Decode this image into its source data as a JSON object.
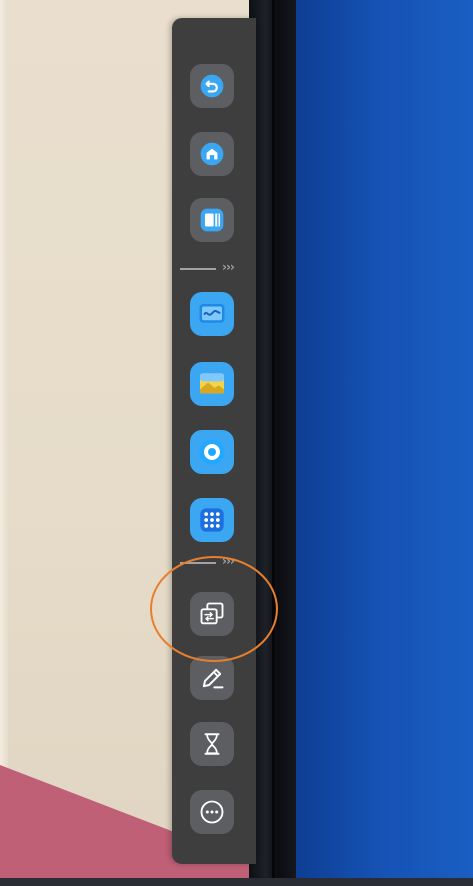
{
  "toolbar": {
    "separator_chevrons": "›››",
    "buttons": [
      {
        "name": "back-button",
        "icon": "undo-arrow-icon"
      },
      {
        "name": "home-button",
        "icon": "home-icon"
      },
      {
        "name": "multitask-button",
        "icon": "recent-apps-icon"
      },
      {
        "name": "whiteboard-app-button",
        "icon": "whiteboard-wave-icon"
      },
      {
        "name": "gallery-app-button",
        "icon": "image-icon"
      },
      {
        "name": "media-app-button",
        "icon": "disc-icon"
      },
      {
        "name": "apps-grid-button",
        "icon": "app-grid-icon"
      },
      {
        "name": "screen-share-button",
        "icon": "window-switch-icon"
      },
      {
        "name": "annotate-button",
        "icon": "pencil-icon"
      },
      {
        "name": "timer-button",
        "icon": "hourglass-icon"
      },
      {
        "name": "more-button",
        "icon": "more-dots-icon"
      }
    ]
  },
  "colors": {
    "toolbar_bg": "#3f3e3f",
    "button_bg": "#5d5e62",
    "app_tile": "#3ba7f2",
    "highlight_ring": "#e77f2c",
    "screen_blue": "#1552b3",
    "wall": "#e7dccb"
  }
}
